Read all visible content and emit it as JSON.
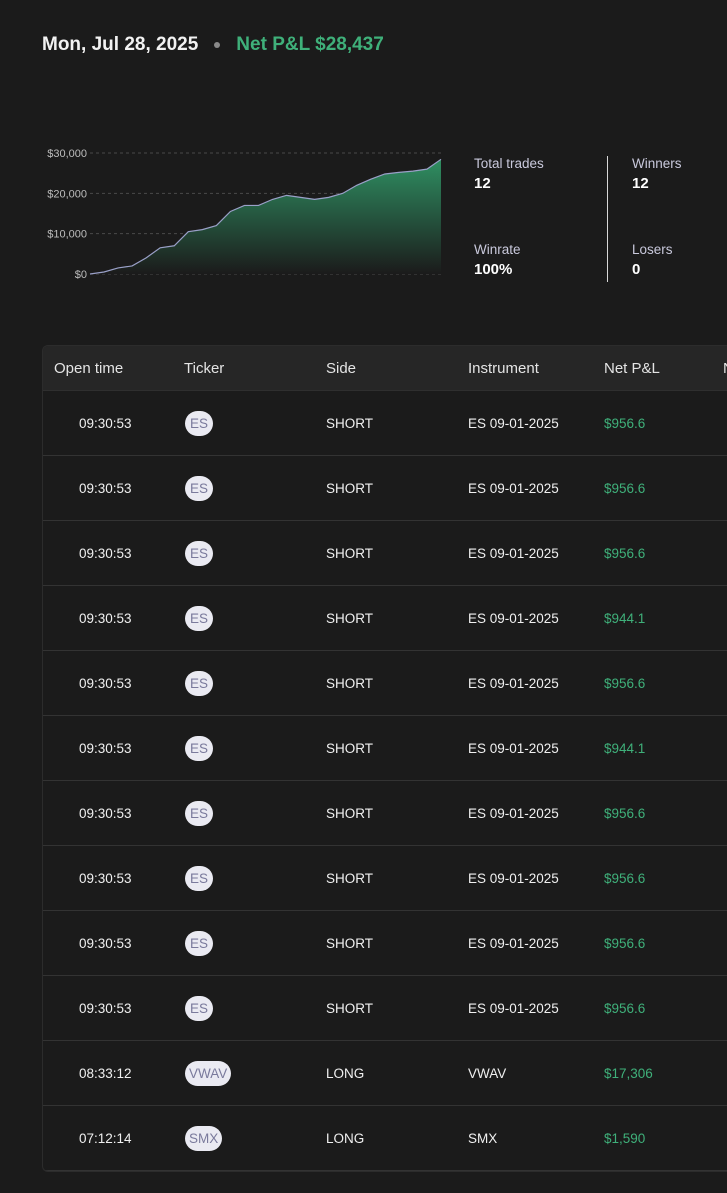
{
  "header": {
    "date": "Mon, Jul 28, 2025",
    "net_pnl": "Net P&L $28,437"
  },
  "chart_data": {
    "type": "area",
    "x": [
      0,
      1,
      2,
      3,
      4,
      5,
      6,
      7,
      8,
      9,
      10,
      11,
      12,
      13,
      14,
      15,
      16,
      17,
      18,
      19,
      20,
      21,
      22,
      23,
      24,
      25
    ],
    "y": [
      0,
      500,
      1500,
      2000,
      4000,
      6500,
      7000,
      10500,
      11000,
      12000,
      15500,
      17000,
      17000,
      18500,
      19500,
      19000,
      18500,
      19000,
      20000,
      22000,
      23500,
      24800,
      25200,
      25500,
      26000,
      28437
    ],
    "y_ticks": [
      "$0",
      "$10,000",
      "$20,000",
      "$30,000"
    ],
    "ylim": [
      0,
      30000
    ],
    "grid": true,
    "colors": {
      "line": "#9aa0c8",
      "fill_top": "#2f8f62",
      "fill_bottom": "#1b1b1b"
    }
  },
  "stats": {
    "total_trades_label": "Total trades",
    "total_trades": "12",
    "winners_label": "Winners",
    "winners": "12",
    "winrate_label": "Winrate",
    "winrate": "100%",
    "losers_label": "Losers",
    "losers": "0"
  },
  "table": {
    "columns": [
      "Open time",
      "Ticker",
      "Side",
      "Instrument",
      "Net P&L",
      "N"
    ],
    "rows": [
      {
        "time": "09:30:53",
        "ticker": "ES",
        "side": "SHORT",
        "instrument": "ES 09-01-2025",
        "pnl": "$956.6"
      },
      {
        "time": "09:30:53",
        "ticker": "ES",
        "side": "SHORT",
        "instrument": "ES 09-01-2025",
        "pnl": "$956.6"
      },
      {
        "time": "09:30:53",
        "ticker": "ES",
        "side": "SHORT",
        "instrument": "ES 09-01-2025",
        "pnl": "$956.6"
      },
      {
        "time": "09:30:53",
        "ticker": "ES",
        "side": "SHORT",
        "instrument": "ES 09-01-2025",
        "pnl": "$944.1"
      },
      {
        "time": "09:30:53",
        "ticker": "ES",
        "side": "SHORT",
        "instrument": "ES 09-01-2025",
        "pnl": "$956.6"
      },
      {
        "time": "09:30:53",
        "ticker": "ES",
        "side": "SHORT",
        "instrument": "ES 09-01-2025",
        "pnl": "$944.1"
      },
      {
        "time": "09:30:53",
        "ticker": "ES",
        "side": "SHORT",
        "instrument": "ES 09-01-2025",
        "pnl": "$956.6"
      },
      {
        "time": "09:30:53",
        "ticker": "ES",
        "side": "SHORT",
        "instrument": "ES 09-01-2025",
        "pnl": "$956.6"
      },
      {
        "time": "09:30:53",
        "ticker": "ES",
        "side": "SHORT",
        "instrument": "ES 09-01-2025",
        "pnl": "$956.6"
      },
      {
        "time": "09:30:53",
        "ticker": "ES",
        "side": "SHORT",
        "instrument": "ES 09-01-2025",
        "pnl": "$956.6"
      },
      {
        "time": "08:33:12",
        "ticker": "VWAV",
        "side": "LONG",
        "instrument": "VWAV",
        "pnl": "$17,306"
      },
      {
        "time": "07:12:14",
        "ticker": "SMX",
        "side": "LONG",
        "instrument": "SMX",
        "pnl": "$1,590"
      }
    ]
  }
}
